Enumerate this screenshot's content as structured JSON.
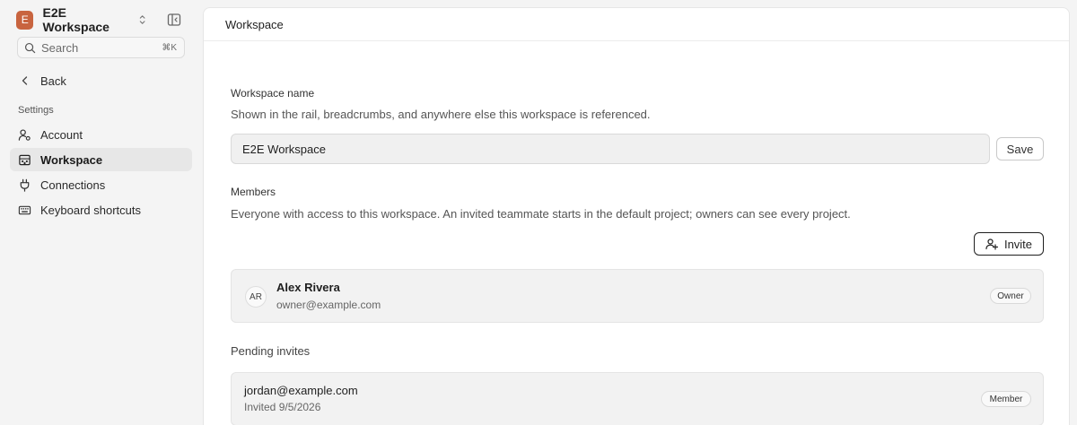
{
  "workspace_switcher": {
    "initial": "E",
    "name": "E2E Workspace",
    "avatar_color": "#c8643f"
  },
  "search": {
    "placeholder": "Search",
    "shortcut": "⌘K"
  },
  "back": {
    "label": "Back"
  },
  "sidebar": {
    "section_label": "Settings",
    "items": [
      {
        "label": "Account",
        "icon": "user-settings-icon",
        "active": false
      },
      {
        "label": "Workspace",
        "icon": "building-icon",
        "active": true
      },
      {
        "label": "Connections",
        "icon": "plug-icon",
        "active": false
      },
      {
        "label": "Keyboard shortcuts",
        "icon": "keyboard-icon",
        "active": false
      }
    ]
  },
  "header": {
    "title": "Workspace"
  },
  "workspace_name": {
    "label": "Workspace name",
    "description": "Shown in the rail, breadcrumbs, and anywhere else this workspace is referenced.",
    "value": "E2E Workspace",
    "save_label": "Save"
  },
  "members": {
    "label": "Members",
    "description": "Everyone with access to this workspace. An invited teammate starts in the default project; owners can see every project.",
    "invite_label": "Invite",
    "list": [
      {
        "initials": "AR",
        "name": "Alex Rivera",
        "email": "owner@example.com",
        "role": "Owner"
      }
    ]
  },
  "pending": {
    "label": "Pending invites",
    "list": [
      {
        "email": "jordan@example.com",
        "invited": "Invited 9/5/2026",
        "role": "Member"
      }
    ]
  }
}
